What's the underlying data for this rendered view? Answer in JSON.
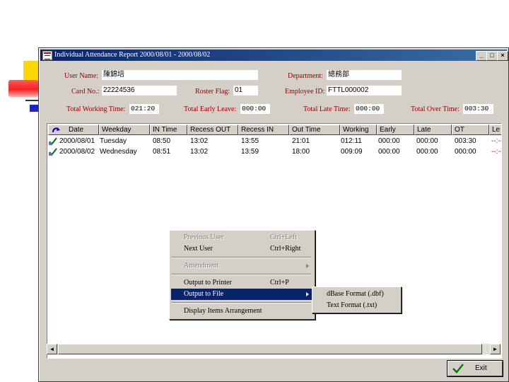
{
  "window": {
    "title": "Individual Attendance Report  2000/08/01  -  2000/08/02",
    "min": "_",
    "max": "□",
    "close": "×"
  },
  "form": {
    "user_name": {
      "label": "User Name:",
      "value": "陳錦培"
    },
    "department": {
      "label": "Department:",
      "value": "總務部"
    },
    "card_no": {
      "label": "Card No.:",
      "value": "22224536"
    },
    "roster_flag": {
      "label": "Roster Flag:",
      "value": "01"
    },
    "employee_id": {
      "label": "Employee ID:",
      "value": "FTTL000002"
    },
    "total_working": {
      "label": "Total Working Time:",
      "value": "021:20"
    },
    "total_early": {
      "label": "Total Early Leave:",
      "value": "000:00"
    },
    "total_late": {
      "label": "Total Late Time:",
      "value": "000:00"
    },
    "total_over": {
      "label": "Total Over Time:",
      "value": "003:30"
    }
  },
  "table": {
    "columns": [
      "Date",
      "Weekday",
      "IN Time",
      "Recess OUT",
      "Recess IN",
      "Out Time",
      "Working",
      "Early",
      "Late",
      "OT",
      "Le"
    ],
    "rows": [
      [
        "2000/08/01",
        "Tuesday",
        "08:50",
        "13:02",
        "13:55",
        "21:01",
        "012:11",
        "000:00",
        "000:00",
        "003:30",
        "--:--"
      ],
      [
        "2000/08/02",
        "Wednesday",
        "08:51",
        "13:02",
        "13:59",
        "18:00",
        "009:09",
        "000:00",
        "000:00",
        "000:00",
        "--:--"
      ]
    ]
  },
  "context_menu": {
    "items": [
      {
        "label": "Previous User",
        "shortcut": "Ctrl+Left",
        "enabled": false
      },
      {
        "label": "Next User",
        "shortcut": "Ctrl+Right",
        "enabled": true
      },
      {
        "label": "Amendment",
        "shortcut": "",
        "enabled": false
      },
      {
        "label": "Output to Printer",
        "shortcut": "Ctrl+P",
        "enabled": true
      },
      {
        "label": "Output to File",
        "shortcut": "",
        "enabled": true
      },
      {
        "label": "Display Items Arrangement",
        "shortcut": "",
        "enabled": true
      }
    ]
  },
  "submenu": {
    "items": [
      {
        "label": "dBase Format (.dbf)"
      },
      {
        "label": "Text Format (.txt)"
      }
    ]
  },
  "exit_button": {
    "label": "Exit"
  },
  "scrollbar": {
    "left": "◄",
    "right": "►"
  },
  "colors": {
    "titlebar": "#0a246a",
    "label_text": "#a00000",
    "selection": "#0a246a",
    "window_bg": "#d4d0c8"
  }
}
